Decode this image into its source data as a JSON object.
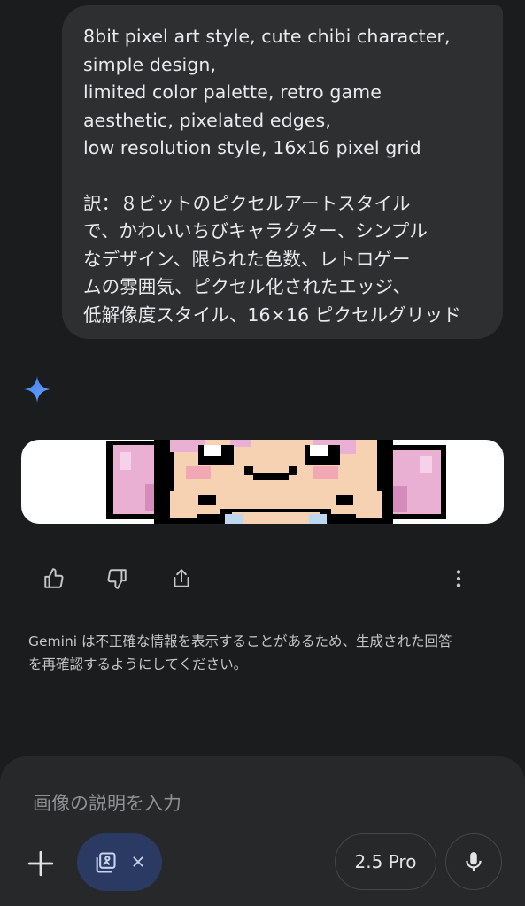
{
  "prompt": {
    "lines": [
      "8bit pixel art style, cute chibi character,",
      "simple design,",
      "limited color palette, retro game",
      "aesthetic, pixelated edges,",
      "low resolution style, 16x16 pixel grid",
      "",
      "訳：８ビットのピクセルアートスタイル",
      "で、かわいいちびキャラクター、シンプル",
      "なデザイン、限られた色数、レトロゲー",
      "ムの雰囲気、ピクセル化されたエッジ、",
      "低解像度スタイル、16×16 ピクセルグリッド"
    ]
  },
  "response": {
    "icon": "gemini-sparkle-icon",
    "image_icon": "pixel-art-chibi-image",
    "actions": [
      "thumbs-up-icon",
      "thumbs-down-icon",
      "share-icon",
      "more-vert-icon"
    ]
  },
  "disclaimer": {
    "line1": "Gemini は不正確な情報を表示することがあるため、生成された回答",
    "line2": "を再確認するようにしてください。"
  },
  "input": {
    "placeholder": "画像の説明を入力",
    "plus_icon": "plus-icon",
    "attachment_icon": "image-edit-icon",
    "attachment_close_icon": "close-icon",
    "model_label": "2.5 Pro",
    "mic_icon": "mic-icon"
  },
  "colors": {
    "background": "#1b1c1d",
    "bubble": "#2e2f30",
    "panel": "#27282a",
    "accent_chip": "#2b3a63",
    "sparkle_blue": "#4f8df7"
  }
}
